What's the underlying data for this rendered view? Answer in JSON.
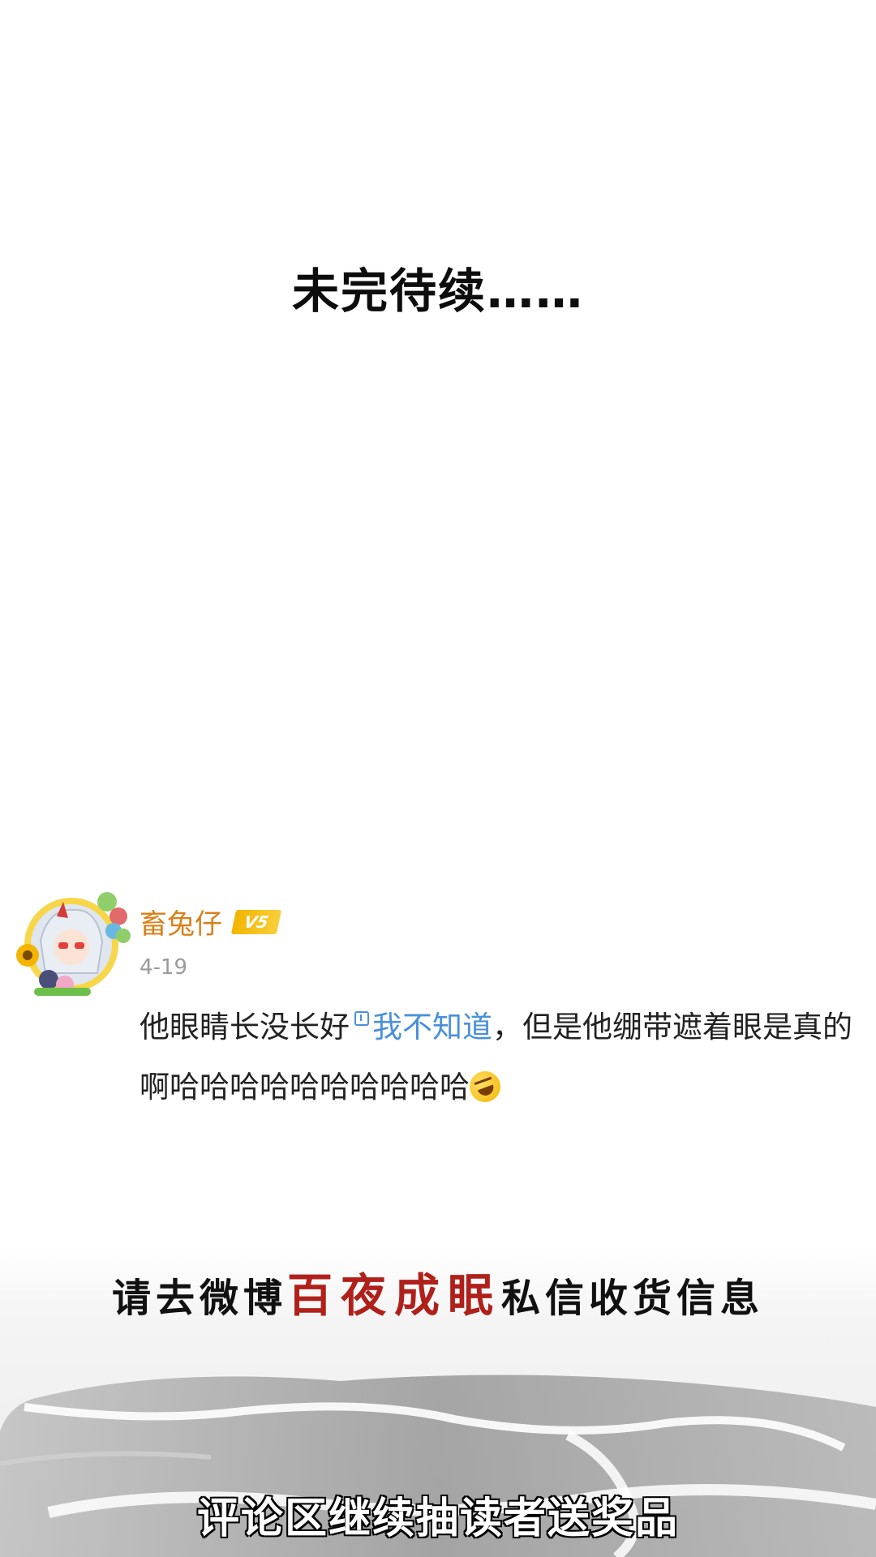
{
  "header": {
    "to_be_continued": "未完待续……"
  },
  "comment": {
    "username": "畜兔仔",
    "badge": "V5",
    "date": "4-19",
    "text_before_link": "他眼睛长没长好",
    "link_text": "我不知道",
    "text_after_link": "，但是他绷带遮着眼是真的啊哈哈哈哈哈哈哈哈哈哈",
    "emoji": "rolling-on-floor-laughing-icon",
    "colors": {
      "username": "#d9801a",
      "link": "#4a90d9",
      "badge": "#f3b400"
    }
  },
  "promo": {
    "line1_prefix": "请去微博",
    "line1_highlight": "百夜成眠",
    "line1_suffix": "私信收货信息",
    "line2": "评论区继续抽读者送奖品",
    "highlight_color": "#b0201b"
  }
}
